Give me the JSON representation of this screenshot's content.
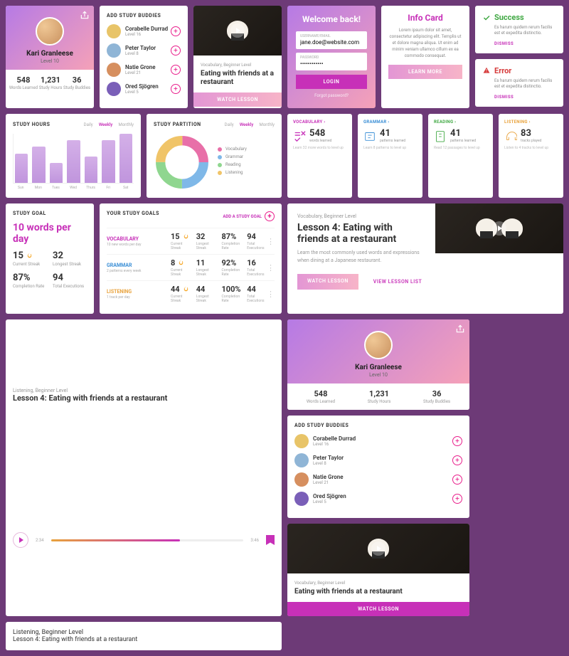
{
  "profile": {
    "name": "Kari Granleese",
    "level": "Level 10",
    "stats": [
      {
        "n": "548",
        "l": "Words Learned"
      },
      {
        "n": "1,231",
        "l": "Study Hours"
      },
      {
        "n": "36",
        "l": "Study Buddies"
      }
    ]
  },
  "buddies": {
    "heading": "ADD STUDY BUDDIES",
    "list": [
      {
        "name": "Corabelle Durrad",
        "level": "Level 16",
        "c": "#e8c468"
      },
      {
        "name": "Peter Taylor",
        "level": "Level 8",
        "c": "#8fb5d6"
      },
      {
        "name": "Natie Grone",
        "level": "Level 21",
        "c": "#d68f5f"
      },
      {
        "name": "Ored Sjögren",
        "level": "Level 5",
        "c": "#7a5fb8"
      }
    ]
  },
  "lesson_small": {
    "tag": "Vocabulary, Beginner Level",
    "title": "Eating with friends at a restaurant",
    "watch": "WATCH LESSON"
  },
  "login": {
    "title": "Welcome back!",
    "user_lbl": "USERNAME/EMAIL",
    "user_val": "jane.doe@website.com",
    "pass_lbl": "PASSWORD",
    "pass_val": "••••••••••••",
    "button": "LOGIN",
    "forgot": "Forgot password?"
  },
  "info": {
    "title": "Info Card",
    "body": "Lorem ipsum dolor sit amet, consectetur adipiscing elit. Templis ut et dolore magna aliqua. Ut enim ad minim veniam ullamco cillum ex ea commodo consequat.",
    "button": "LEARN MORE"
  },
  "success": {
    "title": "Success",
    "body": "Es harum quidem rerum facilis est et expedita distinctio.",
    "dismiss": "DISMISS"
  },
  "error": {
    "title": "Error",
    "body": "Es harum quidem rerum facilis est et expedita distinctio.",
    "dismiss": "DISMISS"
  },
  "study_hours": {
    "title": "STUDY HOURS",
    "tabs": [
      "Daily",
      "Weekly",
      "Monthly"
    ],
    "active": 1
  },
  "partition": {
    "title": "STUDY PARTITION",
    "tabs": [
      "Daily",
      "Weekly",
      "Monthly"
    ],
    "active": 1,
    "legend": [
      {
        "l": "Vocabulary",
        "c": "#e86fa8"
      },
      {
        "l": "Grammar",
        "c": "#7fb8e8"
      },
      {
        "l": "Reading",
        "c": "#8fd68f"
      },
      {
        "l": "Listening",
        "c": "#f0c468"
      }
    ]
  },
  "chart_data": [
    {
      "type": "bar",
      "title": "STUDY HOURS",
      "categories": [
        "Sun",
        "Mon",
        "Tues",
        "Wed",
        "Thurs",
        "Fri",
        "Sat"
      ],
      "values": [
        3.6,
        4.4,
        2.4,
        5.2,
        3.2,
        5.2,
        6.0
      ],
      "ylim": [
        0,
        6
      ],
      "ylabel": "",
      "xlabel": ""
    },
    {
      "type": "pie",
      "title": "STUDY PARTITION",
      "series": [
        {
          "name": "Vocabulary",
          "value": 25,
          "color": "#e86fa8"
        },
        {
          "name": "Grammar",
          "value": 25,
          "color": "#7fb8e8"
        },
        {
          "name": "Reading",
          "value": 25,
          "color": "#8fd68f"
        },
        {
          "name": "Listening",
          "value": 25,
          "color": "#f0c468"
        }
      ]
    }
  ],
  "skills": [
    {
      "h": "VOCABULARY ›",
      "c": "#c730b8",
      "n": "548",
      "l": "words learned",
      "f": "Learn 32 more words to level up"
    },
    {
      "h": "GRAMMAR ›",
      "c": "#3b8fd6",
      "n": "41",
      "l": "patterns learned",
      "f": "Learn 8 patterns to level up"
    },
    {
      "h": "READING ›",
      "c": "#3fa842",
      "n": "41",
      "l": "patterns learned",
      "f": "Read 12 passages to level up"
    },
    {
      "h": "LISTENING ›",
      "c": "#e8a23c",
      "n": "83",
      "l": "tracks played",
      "f": "Listen to 4 tracks to level up"
    }
  ],
  "big_lesson": {
    "tag": "Vocabulary, Beginner Level",
    "title": "Lesson 4: Eating with friends at a restaurant",
    "desc": "Learn the most commonly used words and expressions when dining at a Japanese restaurant.",
    "watch": "WATCH LESSON",
    "list": "VIEW LESSON LIST"
  },
  "study_goal": {
    "heading": "STUDY GOAL",
    "goal": "10 words per day",
    "cells": [
      {
        "n": "15",
        "l": "Current Streak",
        "flame": true
      },
      {
        "n": "32",
        "l": "Longest Streak"
      },
      {
        "n": "87%",
        "l": "Completion Rate"
      },
      {
        "n": "94",
        "l": "Total Executions"
      }
    ]
  },
  "goals_table": {
    "heading": "YOUR STUDY GOALS",
    "add": "ADD A STUDY GOAL",
    "rows": [
      {
        "cat": "VOCABULARY",
        "cls": "v",
        "sub": "10 new words per day",
        "cells": [
          {
            "n": "15",
            "flame": true
          },
          {
            "n": "32"
          },
          {
            "n": "87%"
          },
          {
            "n": "94"
          }
        ]
      },
      {
        "cat": "GRAMMAR",
        "cls": "g",
        "sub": "2 patterns every week",
        "cells": [
          {
            "n": "8",
            "flame": true
          },
          {
            "n": "11"
          },
          {
            "n": "92%"
          },
          {
            "n": "16"
          }
        ]
      },
      {
        "cat": "LISTENING",
        "cls": "l",
        "sub": "1 track per day",
        "cells": [
          {
            "n": "44",
            "flame": true
          },
          {
            "n": "44"
          },
          {
            "n": "100%"
          },
          {
            "n": "44"
          }
        ]
      }
    ],
    "col_labels": [
      "Current Streak",
      "Longest Streak",
      "Completion Rate",
      "Total Executions"
    ]
  },
  "player": {
    "tag": "Listening, Beginner Level",
    "title": "Lesson 4: Eating with friends at a restaurant",
    "cur": "2:34",
    "total": "3:46"
  },
  "lesson_small2": {
    "tag": "Vocabulary, Beginner Level",
    "title": "Eating with friends at a restaurant",
    "watch": "WATCH LESSON"
  },
  "bottom_bar": {
    "tag": "Listening, Beginner Level",
    "title": "Lesson 4: Eating with friends at a restaurant"
  }
}
